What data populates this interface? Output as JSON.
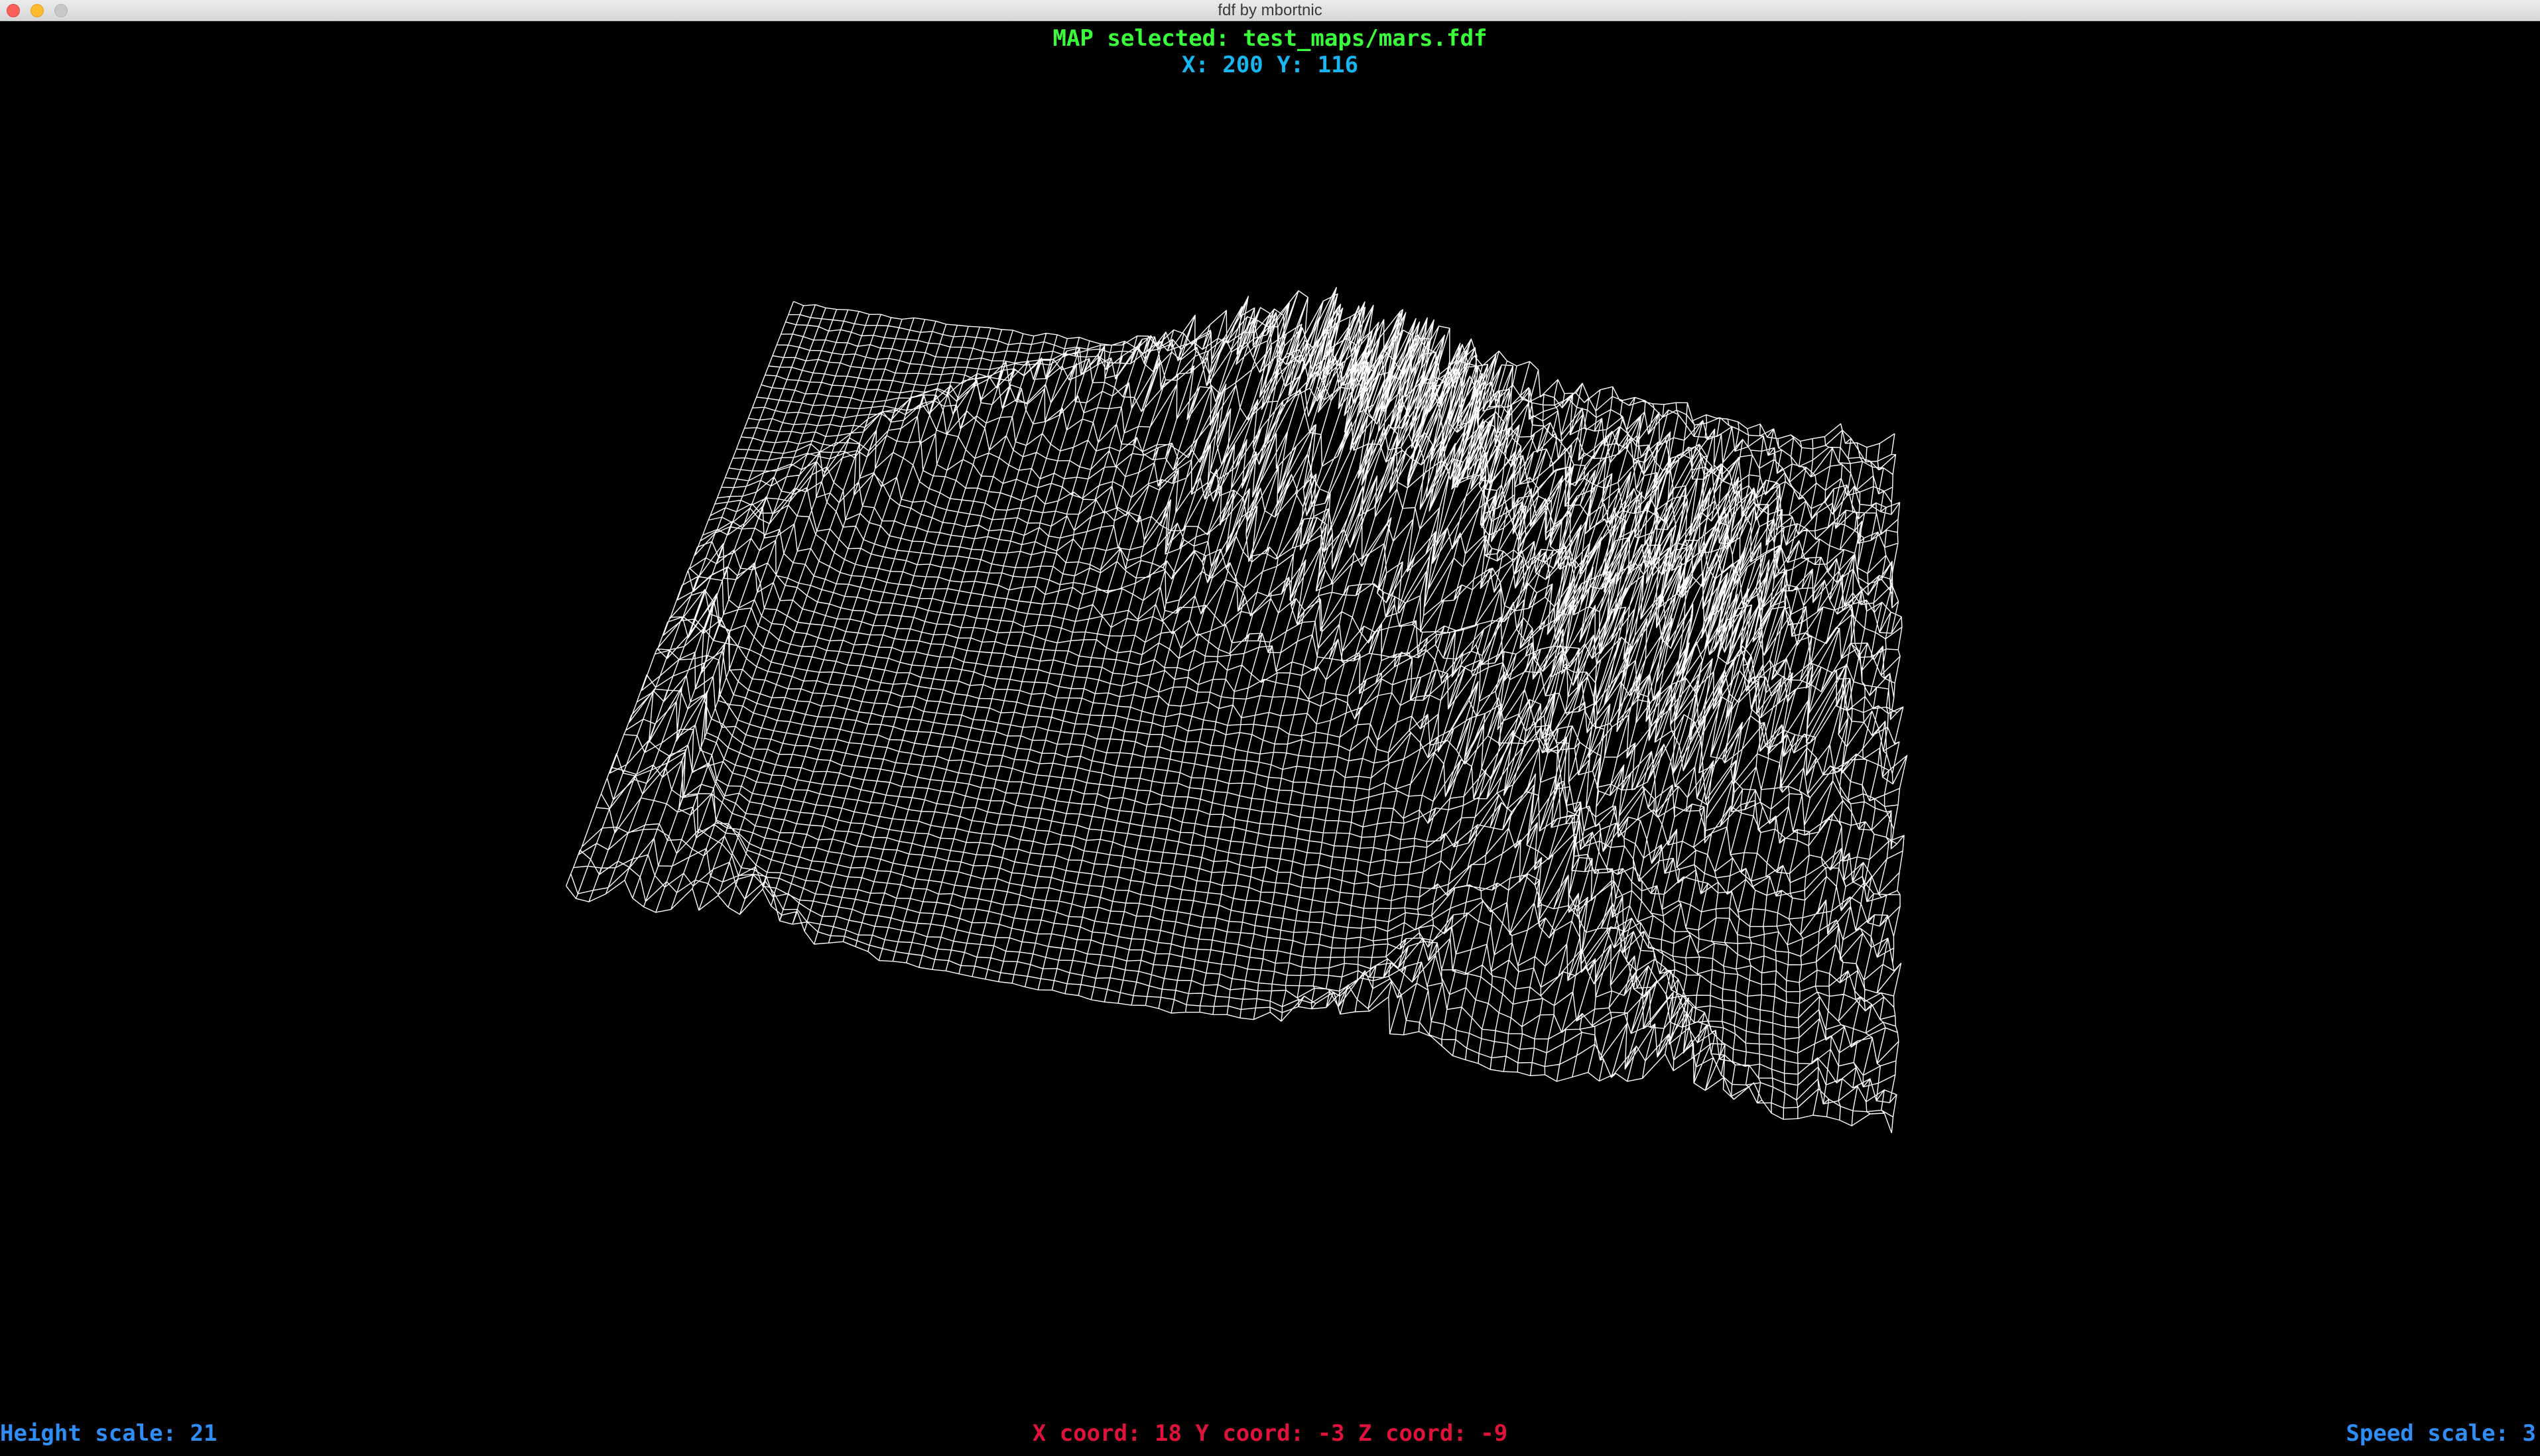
{
  "window": {
    "title": "fdf by mbortnic"
  },
  "hud": {
    "map_selected": "MAP selected: test_maps/mars.fdf",
    "xy": "X: 200 Y: 116",
    "height_scale": "Height scale: 21",
    "coords": "X coord: 18 Y coord: -3 Z coord: -9",
    "speed_scale": "Speed scale: 3"
  },
  "colors": {
    "background": "#000000",
    "wireframe": "#ffffff",
    "map_selected": "#39ff3a",
    "xy": "#18b6f0",
    "scale": "#2f8ef5",
    "coords": "#e0123c"
  },
  "map": {
    "name": "test_maps/mars.fdf",
    "columns": 200,
    "rows": 116,
    "height_scale": 21
  }
}
